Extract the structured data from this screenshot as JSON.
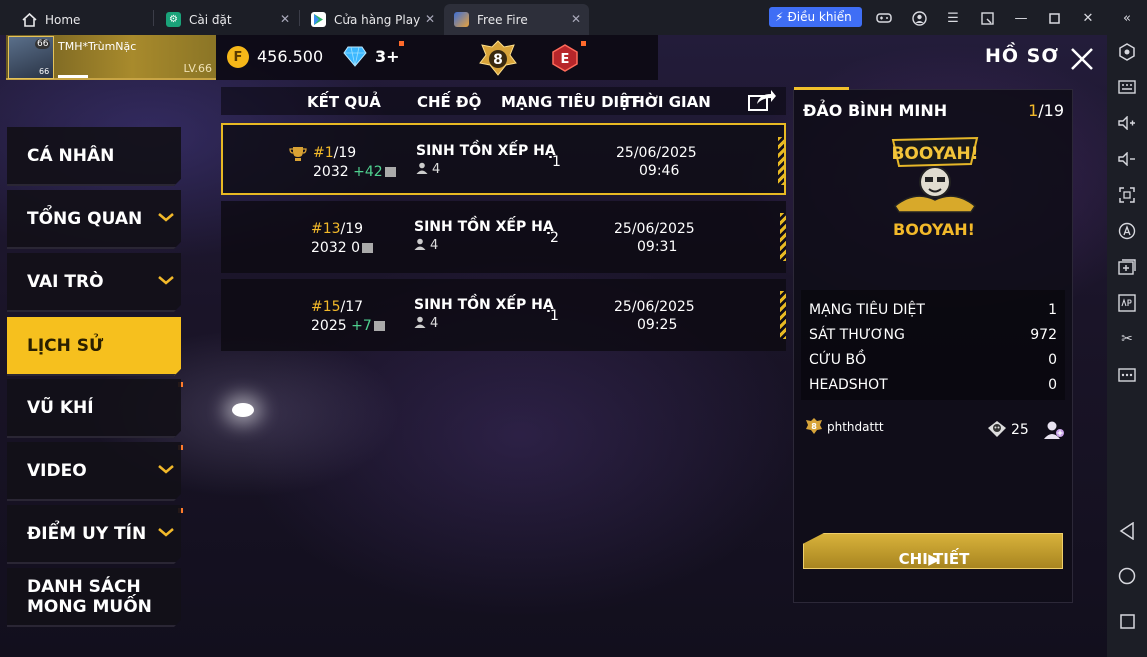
{
  "browser": {
    "tabs": [
      {
        "label": "Home",
        "icon": "home-icon"
      },
      {
        "label": "Cài đặt",
        "icon": "settings-gear-icon"
      },
      {
        "label": "Cửa hàng Play",
        "icon": "play-store-icon"
      },
      {
        "label": "Free Fire",
        "icon": "free-fire-icon"
      }
    ],
    "control_button": "Điều khiển"
  },
  "header": {
    "player_name": "TMH*TrùmNặc",
    "avatar_badge": "66",
    "avatar_level": "66",
    "level": "LV.66",
    "coins": "456.500",
    "coin_symbol": "F",
    "diamonds": "3+",
    "rank_number": "8",
    "e_badge": "E",
    "page_title": "HỒ SƠ"
  },
  "nav": [
    {
      "label": "CÁ NHÂN",
      "chevron": false
    },
    {
      "label": "TỔNG QUAN",
      "chevron": true
    },
    {
      "label": "VAI TRÒ",
      "chevron": true
    },
    {
      "label": "LỊCH SỬ",
      "chevron": false,
      "active": true
    },
    {
      "label": "VŨ KHÍ",
      "chevron": false
    },
    {
      "label": "VIDEO",
      "chevron": true
    },
    {
      "label": "ĐIỂM UY TÍN",
      "chevron": true
    },
    {
      "label_line1": "DANH SÁCH",
      "label_line2": "MONG MUỐN",
      "chevron": false
    }
  ],
  "table": {
    "headers": {
      "result": "KẾT QUẢ",
      "mode": "CHẾ ĐỘ",
      "kills": "MẠNG TIÊU DIỆT",
      "time": "THỜI GIAN"
    },
    "rows": [
      {
        "rank": "#1",
        "total": "/19",
        "points": "2032",
        "delta": "+42",
        "mode": "SINH TỒN XẾP HẠ",
        "players": "4",
        "kills": "1",
        "date": "25/06/2025",
        "time": "09:46",
        "selected": true
      },
      {
        "rank": "#13",
        "total": "/19",
        "points": "2032",
        "delta": "0",
        "mode": "SINH TỒN XẾP HẠ",
        "players": "4",
        "kills": "2",
        "date": "25/06/2025",
        "time": "09:31",
        "selected": false
      },
      {
        "rank": "#15",
        "total": "/17",
        "points": "2025",
        "delta": "+7",
        "mode": "SINH TỒN XẾP HẠ",
        "players": "4",
        "kills": "1",
        "date": "25/06/2025",
        "time": "09:25",
        "selected": false
      }
    ]
  },
  "detail": {
    "map": "ĐẢO BÌNH MINH",
    "page_current": "1",
    "page_total": "/19",
    "booyah_logo_text": "BOOYAH!",
    "result_label": "BOOYAH!",
    "stats": [
      {
        "label": "MẠNG TIÊU DIỆT",
        "value": "1"
      },
      {
        "label": "SÁT THƯƠNG",
        "value": "972"
      },
      {
        "label": "CỨU BỒ",
        "value": "0"
      },
      {
        "label": "HEADSHOT",
        "value": "0"
      }
    ],
    "player": "phthdattt",
    "player_rank": "8",
    "player_count": "25",
    "button": "CHI TIẾT"
  }
}
